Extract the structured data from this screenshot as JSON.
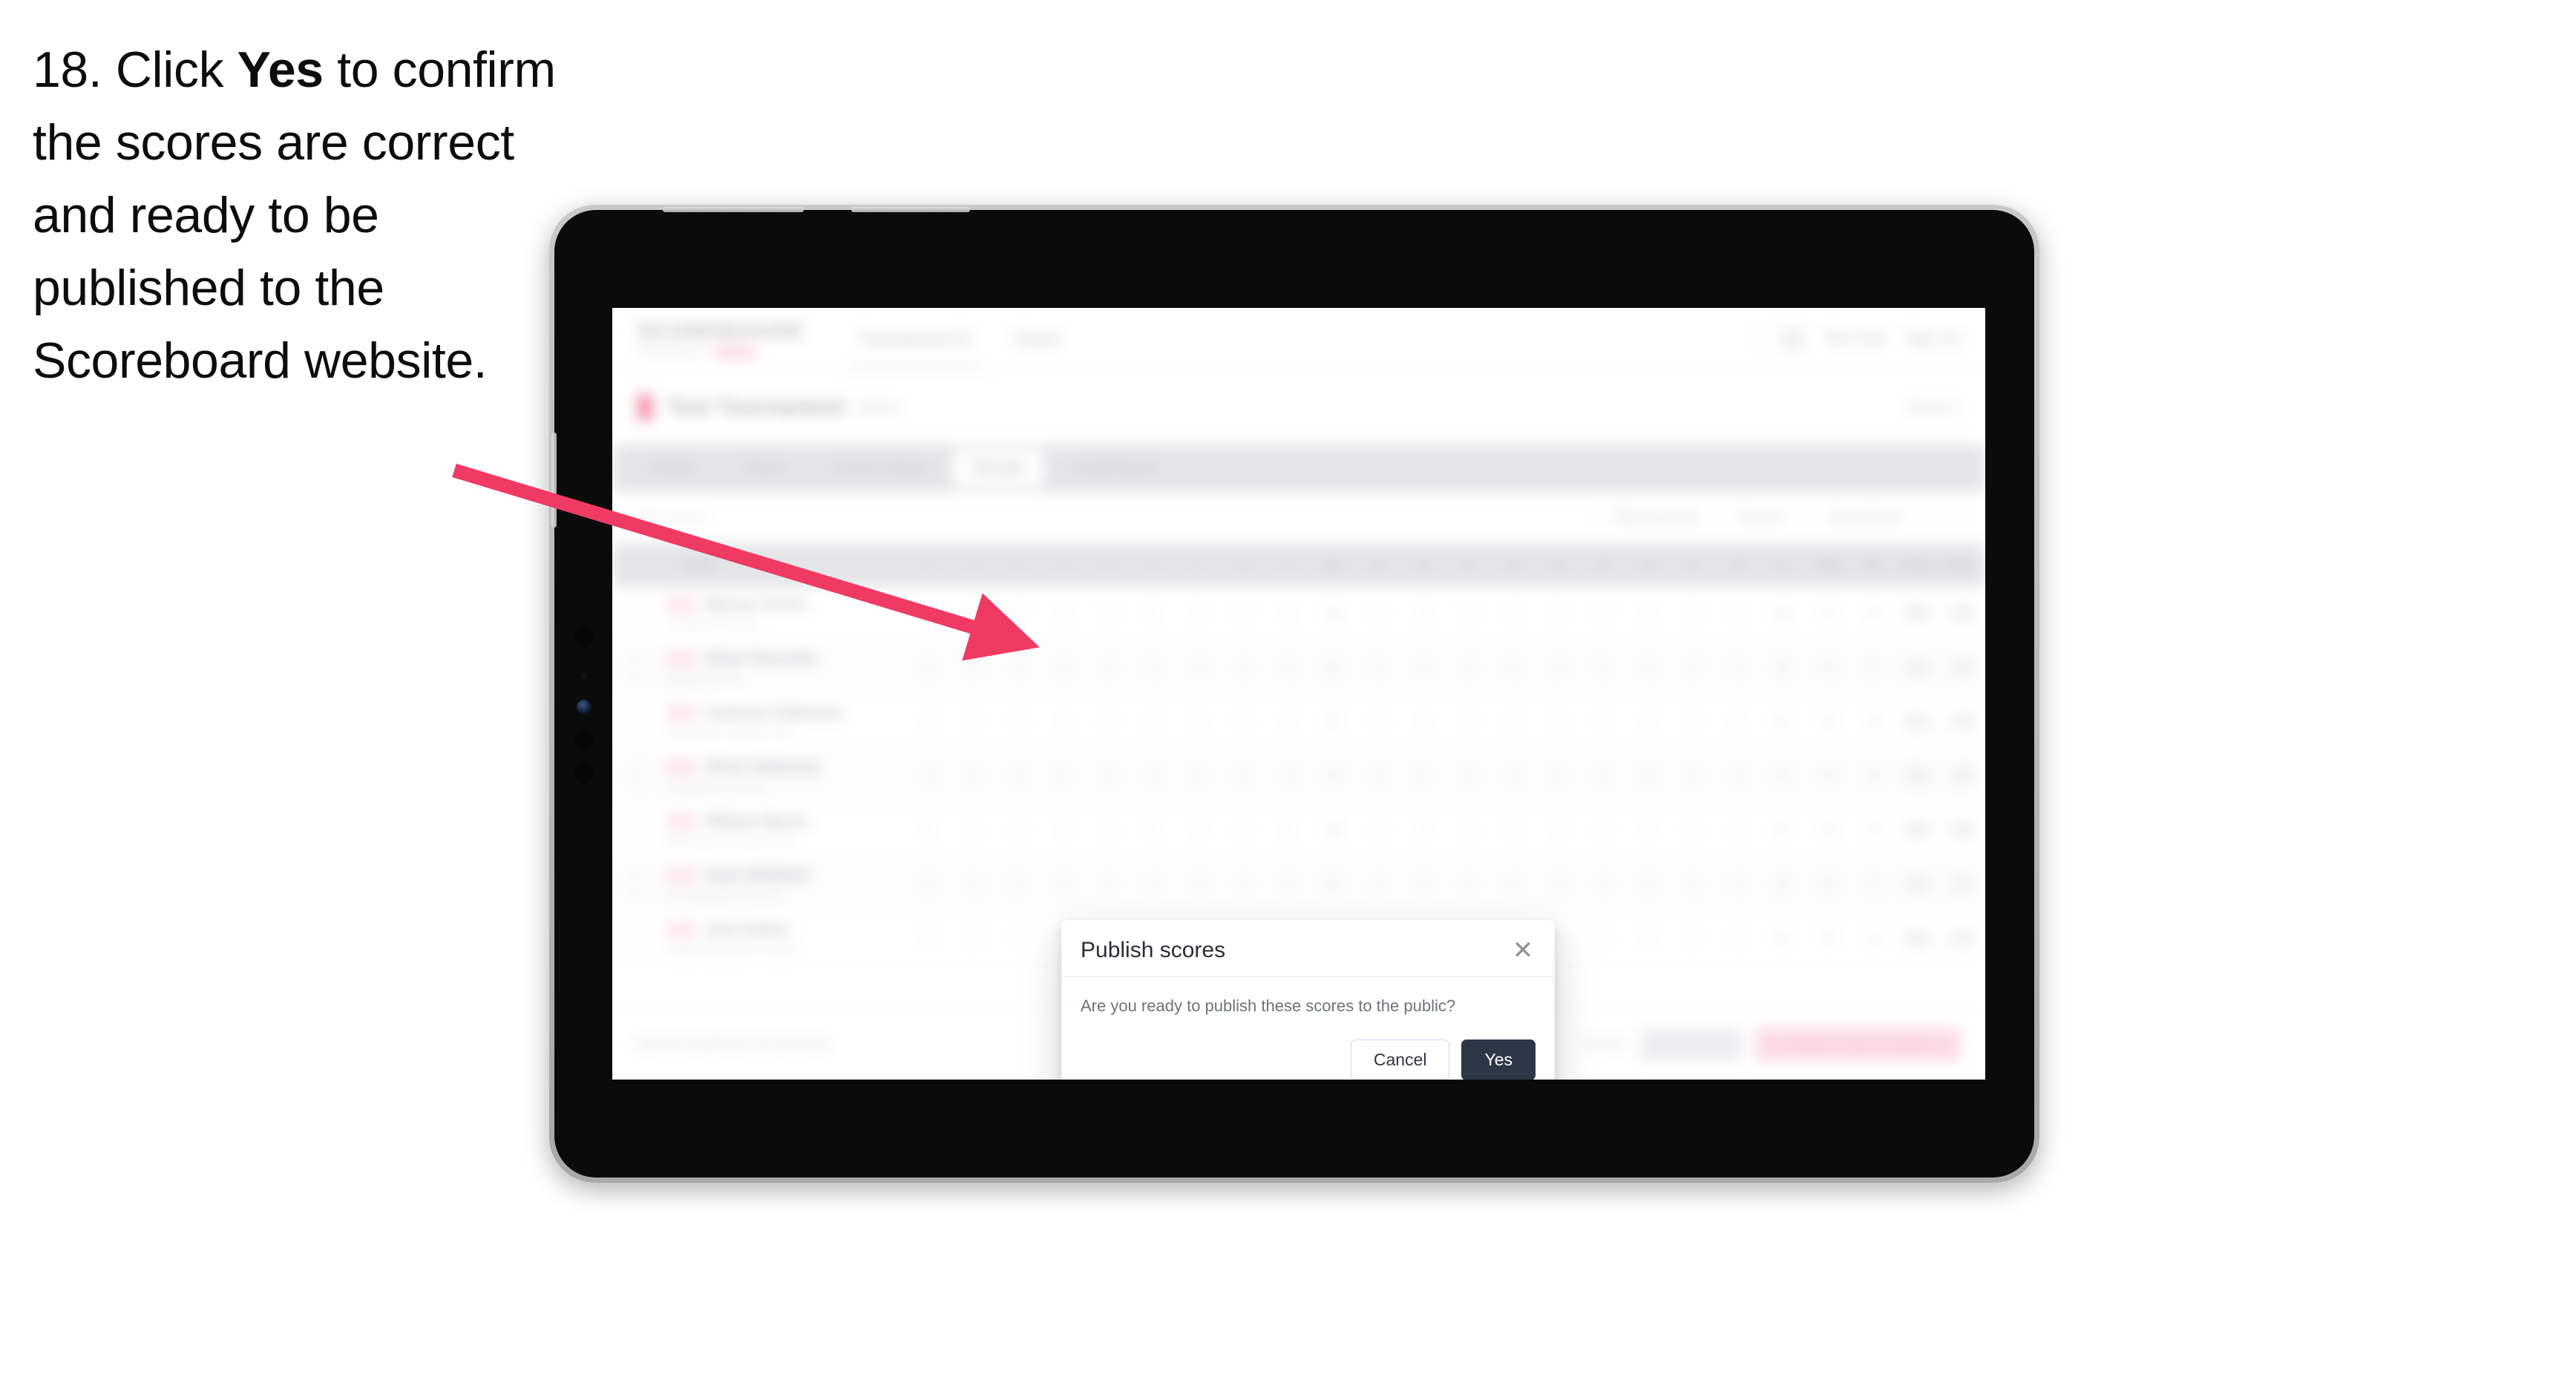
{
  "instruction": {
    "number": "18.",
    "text_before": "Click ",
    "bold_word": "Yes",
    "text_after": " to confirm the scores are correct and ready to be published to the Scoreboard website."
  },
  "colors": {
    "arrow": "#ef3a63",
    "modal_primary_button": "#2d3748",
    "modal_cancel_border": "#ccd7f0",
    "brand_accent": "#f04a72",
    "tab_bar": "#d5d6da",
    "device_bezel": "#0b0b0b",
    "device_edge": "#b9b9bb"
  },
  "device": {
    "type": "tablet"
  },
  "app": {
    "header": {
      "brand_name": "SCOREBOARD",
      "brand_sub": "POWERED BY",
      "brand_chip": "LIVE",
      "nav": [
        {
          "label": "Tournament ID",
          "active": true
        },
        {
          "label": "Event",
          "active": false
        }
      ],
      "avatar_icon": "user-avatar-icon",
      "user_name": "Test User",
      "sign_out": "Sign out"
    },
    "event_bar": {
      "flag_icon": "event-flag-icon",
      "title": "Test Tournament",
      "subtitle": "2024",
      "right_label": "Event 1"
    },
    "tabs": [
      {
        "label": "Details",
        "active": false
      },
      {
        "label": "Teams",
        "active": false
      },
      {
        "label": "Course Setup",
        "active": false
      },
      {
        "label": "Results",
        "active": true
      },
      {
        "label": "Leaderboard",
        "active": false
      }
    ],
    "toolbar": {
      "search_icon": "search-icon",
      "search_placeholder": "Search",
      "filters": [
        {
          "label": "Filter by round"
        },
        {
          "label": "Round 1"
        },
        {
          "label": "Gross Score"
        }
      ],
      "settings_icon": "gear-icon"
    },
    "table": {
      "columns": [
        "Player",
        "1",
        "2",
        "3",
        "4",
        "5",
        "6",
        "7",
        "8",
        "9",
        "Out",
        "10",
        "11",
        "12",
        "13",
        "14",
        "15",
        "16",
        "17",
        "18",
        "In",
        "Total",
        "Net",
        "Points",
        "Status"
      ],
      "rows": [
        {
          "badge": "AM",
          "name": "Marcus Turner",
          "sub": "Coastal Golf Club",
          "scores": [
            "4",
            "5",
            "3",
            "4",
            "4",
            "5",
            "3",
            "4",
            "4",
            "36",
            "4",
            "5",
            "4",
            "3",
            "5",
            "4",
            "4",
            "3",
            "4",
            "36",
            "72",
            "70",
            "86",
            "78"
          ],
          "status": "Ready"
        },
        {
          "badge": "AM",
          "name": "Ethan Reynolds",
          "sub": "Highland Links",
          "scores": [
            "5",
            "4",
            "4",
            "5",
            "3",
            "4",
            "4",
            "4",
            "4",
            "37",
            "5",
            "4",
            "3",
            "4",
            "4",
            "5",
            "4",
            "4",
            "4",
            "37",
            "74",
            "71",
            "84",
            "76"
          ],
          "status": "Ready"
        },
        {
          "badge": "AM",
          "name": "Cameron Patterson",
          "sub": "Riverbend Country Club",
          "scores": [
            "4",
            "4",
            "3",
            "4",
            "5",
            "4",
            "4",
            "5",
            "4",
            "37",
            "4",
            "4",
            "4",
            "4",
            "3",
            "5",
            "4",
            "4",
            "5",
            "37",
            "74",
            "72",
            "82",
            "75"
          ],
          "status": "Ready"
        },
        {
          "badge": "AM",
          "name": "Oliver Hathaway",
          "sub": "Westfield Golf Club",
          "scores": [
            "4",
            "5",
            "4",
            "4",
            "4",
            "4",
            "3",
            "5",
            "4",
            "37",
            "5",
            "4",
            "4",
            "3",
            "4",
            "4",
            "5",
            "4",
            "4",
            "37",
            "74",
            "70",
            "88",
            "80"
          ],
          "status": "Ready"
        },
        {
          "badge": "AM",
          "name": "William Mason",
          "sub": "Birchwood Country Club",
          "scores": [
            "5",
            "4",
            "4",
            "4",
            "3",
            "5",
            "4",
            "4",
            "5",
            "38",
            "4",
            "5",
            "4",
            "4",
            "4",
            "3",
            "4",
            "5",
            "4",
            "37",
            "75",
            "73",
            "90",
            "82"
          ],
          "status": "Ready"
        },
        {
          "badge": "AM",
          "name": "Noah Whitfield",
          "sub": "Stonebridge Golf Club",
          "scores": [
            "4",
            "4",
            "5",
            "4",
            "4",
            "4",
            "4",
            "4",
            "4",
            "37",
            "4",
            "4",
            "5",
            "4",
            "4",
            "4",
            "3",
            "5",
            "4",
            "37",
            "74",
            "71",
            "85",
            "77"
          ],
          "status": "Ready"
        },
        {
          "badge": "AM",
          "name": "Jack Sutton",
          "sub": "Maple Ridge Golf Course",
          "scores": [
            "4",
            "5",
            "4",
            "3",
            "4",
            "5",
            "4",
            "4",
            "4",
            "37",
            "5",
            "4",
            "4",
            "4",
            "4",
            "4",
            "4",
            "4",
            "4",
            "37",
            "74",
            "72",
            "84",
            "76"
          ],
          "status": "Ready"
        }
      ]
    },
    "footer": {
      "note": "Results published successfully",
      "cancel_label": "Cancel",
      "secondary_label": "Save All",
      "primary_label": "Publish scores to public"
    }
  },
  "modal": {
    "title": "Publish scores",
    "close_icon": "close-icon",
    "body": "Are you ready to publish these scores to the public?",
    "cancel_label": "Cancel",
    "confirm_label": "Yes"
  }
}
